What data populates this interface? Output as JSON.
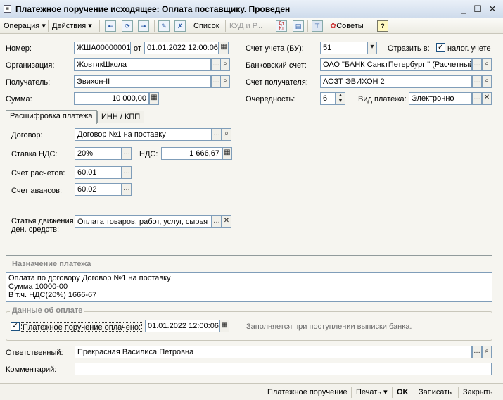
{
  "window": {
    "title": "Платежное поручение исходящее: Оплата поставщику. Проведен",
    "icon": "document-icon"
  },
  "toolbar": {
    "operation": "Операция",
    "actions": "Действия",
    "list": "Список",
    "kud": "КУД и Р...",
    "advice": "Советы",
    "help": "?",
    "dtkt": "Дт Кт"
  },
  "form": {
    "number_label": "Номер:",
    "number_value": "ЖШA00000001",
    "from_label": "от",
    "date_value": "01.01.2022 12:00:06",
    "org_label": "Организация:",
    "org_value": "ЖовтякШкола",
    "recipient_label": "Получатель:",
    "recipient_value": "Эвихон-II",
    "sum_label": "Сумма:",
    "sum_value": "10 000,00",
    "account_label": "Счет учета (БУ):",
    "account_value": "51",
    "reflect_label": "Отразить в:",
    "tax_label": "налог. учете",
    "bank_label": "Банковский счет:",
    "bank_value": "ОАО \"БАНК СанктПетербург \" (Расчетный)",
    "recipient_account_label": "Счет получателя:",
    "recipient_account_value": "АОЗТ ЭВИХОН 2",
    "priority_label": "Очередность:",
    "priority_value": "6",
    "payment_type_label": "Вид платежа:",
    "payment_type_value": "Электронно"
  },
  "tabs": [
    {
      "label": "Расшифровка платежа"
    },
    {
      "label": "ИНН / КПП"
    }
  ],
  "details": {
    "contract_label": "Договор:",
    "contract_value": "Договор №1 на поставку",
    "vat_rate_label": "Ставка НДС:",
    "vat_rate_value": "20%",
    "vat_label": "НДС:",
    "vat_value": "1 666,67",
    "settlement_label": "Счет расчетов:",
    "settlement_value": "60.01",
    "advance_label": "Счет авансов:",
    "advance_value": "60.02",
    "cashflow_label_1": "Статья движения",
    "cashflow_label_2": "ден. средств:",
    "cashflow_value": "Оплата товаров, работ, услуг, сырья"
  },
  "purpose": {
    "title": "Назначение платежа",
    "line1": "Оплата по договору Договор №1 на поставку",
    "line2": "Сумма 10000-00",
    "line3": "В т.ч. НДС(20%) 1666-67"
  },
  "payment": {
    "title": "Данные об оплате",
    "paid_label": "Платежное поручение оплачено:",
    "paid_date": "01.01.2022 12:00:06",
    "hint": "Заполняется при поступлении выписки банка."
  },
  "footer_fields": {
    "responsible_label": "Ответственный:",
    "responsible_value": "Прекрасная Василиса Петровна",
    "comment_label": "Комментарий:",
    "comment_value": ""
  },
  "statusbar": {
    "print_form": "Платежное поручение",
    "print": "Печать",
    "ok": "OK",
    "save": "Записать",
    "close": "Закрыть"
  },
  "colors": {
    "accent": "#1c5180",
    "field_border": "#7f9db9",
    "background": "#f6f5f0"
  }
}
